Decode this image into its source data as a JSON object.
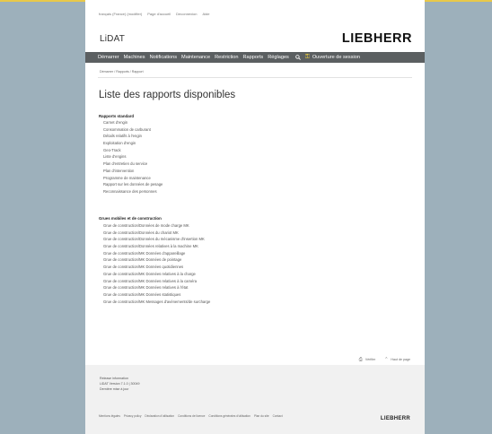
{
  "utility_links": [
    "français (France) (modifier)",
    "Page d'accueil",
    "Deconnexion",
    "Aide"
  ],
  "app_name": "LiDAT",
  "logo": "LIEBHERR",
  "nav": {
    "items": [
      "Démarrer",
      "Machines",
      "Notifications",
      "Maintenance",
      "Restriction",
      "Rapports",
      "Réglages"
    ],
    "login": "Ouverture de session"
  },
  "breadcrumb": {
    "home": "Démarrer",
    "sep1": "/",
    "reports": "Rapports",
    "sep2": "/",
    "current": "Rapport"
  },
  "title": "Liste des rapports disponibles",
  "sections": [
    {
      "heading": "Rapports standard",
      "items": [
        "Carnet d'engin",
        "Consommation de carburant",
        "Détails relatifs à l'engin",
        "Exploitation d'engin",
        "Geo-Track",
        "Liste d'engins",
        "Plan d'entretien du service",
        "Plan d'intervention",
        "Programme de maintenance",
        "Rapport sur les données de pesage",
        "Reconnaissance des personnes"
      ]
    },
    {
      "heading": "Grues mobiles et de construction",
      "items": [
        "Grue de construction/Données de mode charge MK",
        "Grue de construction/Données du chariot MK",
        "Grue de construction/Données du mécanisme d'insertion MK",
        "Grue de construction/Données relatives à la machine MK",
        "Grue de construction/MK Données d'appareillage",
        "Grue de construction/MK Données de pointage",
        "Grue de construction/MK Données quotidiennes",
        "Grue de construction/MK Données relatives à la charge",
        "Grue de construction/MK Données relatives à la caméra",
        "Grue de construction/MK Données relatives à l'état",
        "Grue de construction/MK Données statistiques",
        "Grue de construction/MK Messages d'avènements/de surcharge"
      ]
    }
  ],
  "footlinks": {
    "print": "Vérifier",
    "top": "Haut de page"
  },
  "release": {
    "heading": "Release information",
    "version": "LiDAT Version 7.1.0 | 30049",
    "date": "Dernière mise à jour"
  },
  "legal_links": [
    "Mentions légales",
    "Privacy policy",
    "Déclaration d'utilisation",
    "Conditions de licence",
    "Conditions générales d'utilisation",
    "Plan du site",
    "Contact"
  ],
  "footer_logo": "LIEBHERR",
  "colors": {
    "nav_bg": "#5b5f61",
    "accent": "#f2d33b",
    "backdrop": "#9db0bb"
  }
}
